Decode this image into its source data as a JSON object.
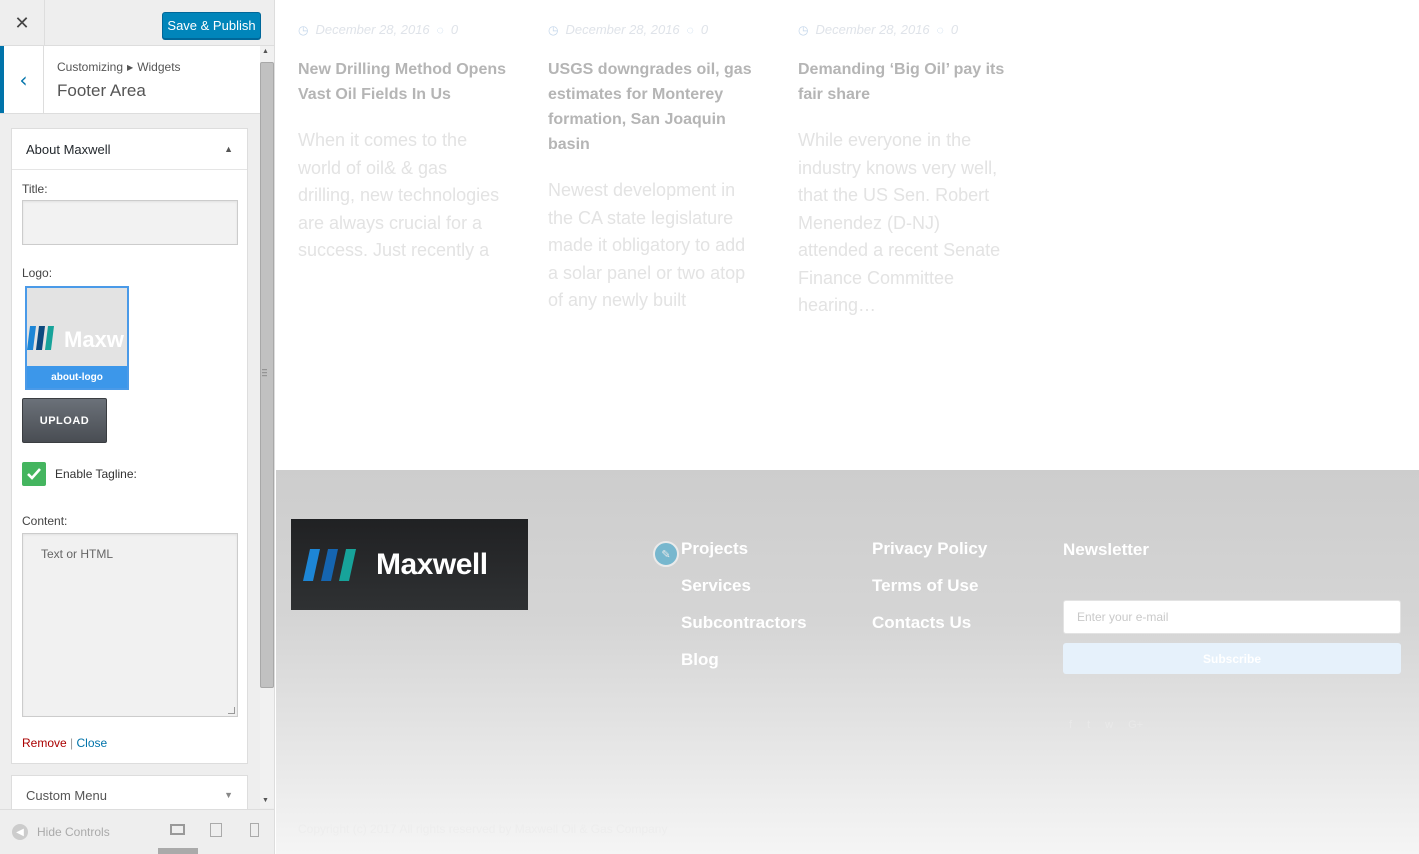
{
  "customizer": {
    "close_icon": "close-icon",
    "save_label": "Save & Publish",
    "breadcrumb": [
      "Customizing",
      "Widgets"
    ],
    "section_title": "Footer Area",
    "widget": {
      "name": "About Maxwell",
      "title_label": "Title:",
      "title_value": "",
      "logo_label": "Logo:",
      "logo_caption": "about-logo",
      "logo_text": "Maxw",
      "upload_label": "UPLOAD",
      "tagline_label": "Enable Tagline:",
      "tagline_checked": true,
      "content_label": "Content:",
      "content_placeholder": "Text or HTML",
      "remove_label": "Remove",
      "close_label": "Close"
    },
    "next_widget": "Custom Menu",
    "hide_controls": "Hide Controls"
  },
  "posts": [
    {
      "date": "December 28, 2016",
      "comments": "0",
      "title": "New Drilling Method Opens Vast Oil Fields In Us",
      "excerpt": "When it comes to the world of oil& & gas drilling, new technologies are always crucial for a success. Just recently a"
    },
    {
      "date": "December 28, 2016",
      "comments": "0",
      "title": "USGS downgrades oil, gas estimates for Monterey formation, San Joaquin basin",
      "excerpt": "Newest development in the CA state legislature made it obligatory to add a solar panel or two atop of any newly built"
    },
    {
      "date": "December 28, 2016",
      "comments": "0",
      "title": "Demanding ‘Big Oil’ pay its fair share",
      "excerpt": "While everyone in the industry knows very well, that the US Sen. Robert Menendez (D-NJ) attended a recent Senate Finance Committee hearing…"
    }
  ],
  "footer": {
    "brand": "Maxwell",
    "links_col1": [
      "Projects",
      "Services",
      "Subcontractors",
      "Blog"
    ],
    "links_col2": [
      "Privacy Policy",
      "Terms of Use",
      "Contacts Us"
    ],
    "newsletter_title": "Newsletter",
    "email_placeholder": "Enter your e-mail",
    "subscribe_label": "Subscribe",
    "social": [
      "f",
      "t",
      "w",
      "G+"
    ],
    "copyright": "Copyright (c) 2017 All rights reserved by Maxwell Oil & Gas Company"
  },
  "colors": {
    "accent": "#0085ba",
    "checkbox": "#44b55f",
    "logo_tile": "#3c97ea"
  }
}
